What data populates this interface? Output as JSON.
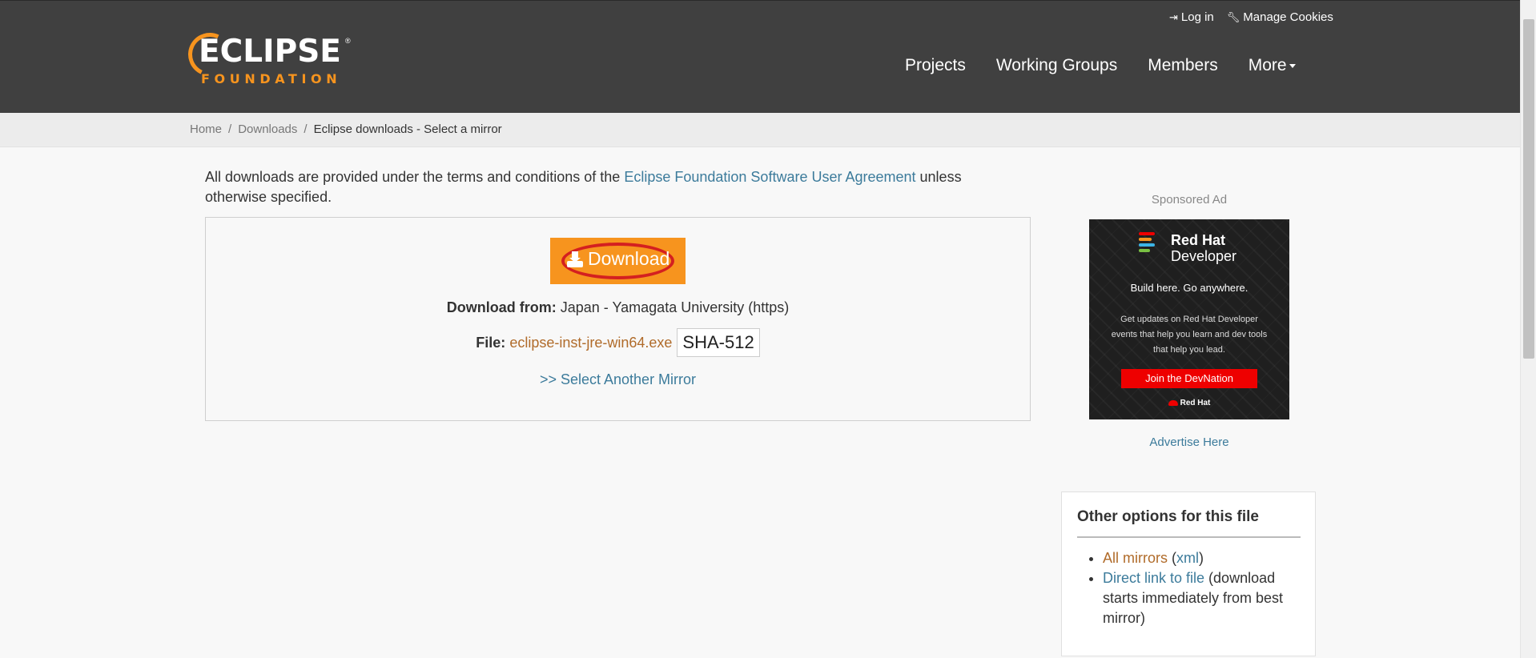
{
  "header": {
    "logo_word": "ECLIPSE",
    "logo_reg": "®",
    "logo_sub": "FOUNDATION",
    "util_links": [
      {
        "icon": "sign-in-icon",
        "label": "Log in"
      },
      {
        "icon": "wrench-icon",
        "label": "Manage Cookies"
      }
    ],
    "nav": [
      "Projects",
      "Working Groups",
      "Members",
      "More"
    ]
  },
  "breadcrumb": {
    "items": [
      "Home",
      "Downloads"
    ],
    "separator": "/",
    "current": "Eclipse downloads - Select a mirror"
  },
  "main": {
    "terms_prefix": "All downloads are provided under the terms and conditions of the ",
    "terms_link": "Eclipse Foundation Software User Agreement",
    "terms_suffix": " unless otherwise specified.",
    "download_button": "Download",
    "download_from_label": "Download from:",
    "download_from_value": " Japan - Yamagata University (https)",
    "file_label": "File:",
    "file_name": "eclipse-inst-jre-win64.exe",
    "checksum": "SHA-512",
    "another_mirror": ">> Select Another Mirror"
  },
  "sidebar": {
    "sponsored_label": "Sponsored Ad",
    "ad": {
      "brand_line1": "Red Hat",
      "brand_line2": "Developer",
      "tagline": "Build here. Go anywhere.",
      "body": "Get updates on Red Hat Developer events that help you learn and dev tools that help you lead.",
      "cta": "Join the DevNation",
      "footer": "Red Hat"
    },
    "advertise_link": "Advertise Here",
    "options": {
      "title": "Other options for this file",
      "all_mirrors": "All mirrors",
      "xml_open": " (",
      "xml": "xml",
      "xml_close": ")",
      "direct_link": "Direct link to file",
      "direct_note": " (download starts immediately from best mirror)"
    }
  },
  "colors": {
    "header_bg": "#404040",
    "accent_orange": "#f7941e",
    "link_blue": "#3c7b9b",
    "link_orange": "#b06b2a",
    "annotation_red": "#d42020"
  }
}
